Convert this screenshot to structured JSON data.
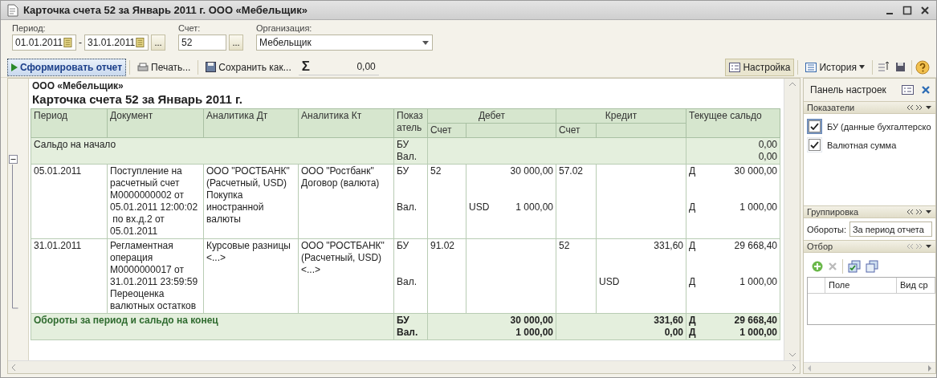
{
  "window": {
    "title": "Карточка счета 52 за Январь 2011 г. ООО «Мебельщик»"
  },
  "filters": {
    "period_label": "Период:",
    "period_from": "01.01.2011",
    "period_dash": "-",
    "period_to": "31.01.2011",
    "period_more": "...",
    "account_label": "Счет:",
    "account": "52",
    "account_more": "...",
    "organization_label": "Организация:",
    "organization": "Мебельщик"
  },
  "toolbar": {
    "generate": "Сформировать отчет",
    "print": "Печать...",
    "save_as": "Сохранить как...",
    "sum_sign": "Σ",
    "sum": "0,00",
    "settings": {
      "label": "Настройка",
      "pressed": true
    },
    "history": "История"
  },
  "report": {
    "company": "ООО «Мебельщик»",
    "title": "Карточка счета 52 за Январь 2011 г.",
    "expanded": true,
    "columns": {
      "period": "Период",
      "document": "Документ",
      "analytics_dt": "Аналитика Дт",
      "analytics_kt": "Аналитика Кт",
      "indicator": "Показ\nатель",
      "debit": "Дебет",
      "credit": "Кредит",
      "balance": "Текущее сальдо",
      "debit_account": "Счет",
      "credit_account": "Счет"
    },
    "opening": {
      "label": "Сальдо на начало",
      "indicators": [
        "БУ",
        "Вал."
      ],
      "balances": [
        "0,00",
        "0,00"
      ]
    },
    "entries": [
      {
        "date": "05.01.2011",
        "document": "Поступление на\nрасчетный счет\nМ0000000002 от\n05.01.2011 12:00:02\n по вх.д.2 от\n05.01.2011",
        "analytics_dt": "ООО \"РОСТБАНК\"\n(Расчетный, USD)\nПокупка\nиностранной\nвалюты",
        "analytics_kt": "ООО \"Ростбанк\"\nДоговор (валюта)",
        "lines": [
          {
            "indicator": "БУ",
            "debit_account": "52",
            "debit": "30 000,00",
            "credit_account": "57.02",
            "side": "Д",
            "balance": "30 000,00"
          },
          {
            "indicator": "Вал.",
            "debit_currency": "USD",
            "debit": "1 000,00",
            "side": "Д",
            "balance": "1 000,00"
          }
        ]
      },
      {
        "date": "31.01.2011",
        "document": "Регламентная\nоперация\nМ0000000017 от\n31.01.2011 23:59:59\nПереоценка\nвалютных остатков",
        "analytics_dt": "Курсовые разницы\n<...>",
        "analytics_kt": "ООО \"РОСТБАНК\"\n(Расчетный, USD)\n<...>",
        "lines": [
          {
            "indicator": "БУ",
            "debit_account": "91.02",
            "credit_account": "52",
            "credit": "331,60",
            "side": "Д",
            "balance": "29 668,40"
          },
          {
            "indicator": "Вал.",
            "credit_currency": "USD",
            "side": "Д",
            "balance": "1 000,00"
          }
        ]
      }
    ],
    "totals": {
      "label": "Обороты за период и сальдо на конец",
      "indicators": [
        "БУ",
        "Вал."
      ],
      "debit": [
        "30 000,00",
        "1 000,00"
      ],
      "credit": [
        "331,60",
        "0,00"
      ],
      "sides": [
        "Д",
        "Д"
      ],
      "balances": [
        "29 668,40",
        "1 000,00"
      ]
    }
  },
  "settings_panel": {
    "title": "Панель настроек",
    "indicators_header": "Показатели",
    "indicators": [
      {
        "label": "БУ (данные бухгалтерско",
        "checked": true,
        "selected": true
      },
      {
        "label": "Валютная сумма",
        "checked": true,
        "selected": false
      }
    ],
    "grouping_header": "Группировка",
    "turnover_label": "Обороты:",
    "turnover_value": "За период отчета",
    "filter_header": "Отбор",
    "filter_columns": [
      "Поле",
      "Вид ср"
    ]
  }
}
